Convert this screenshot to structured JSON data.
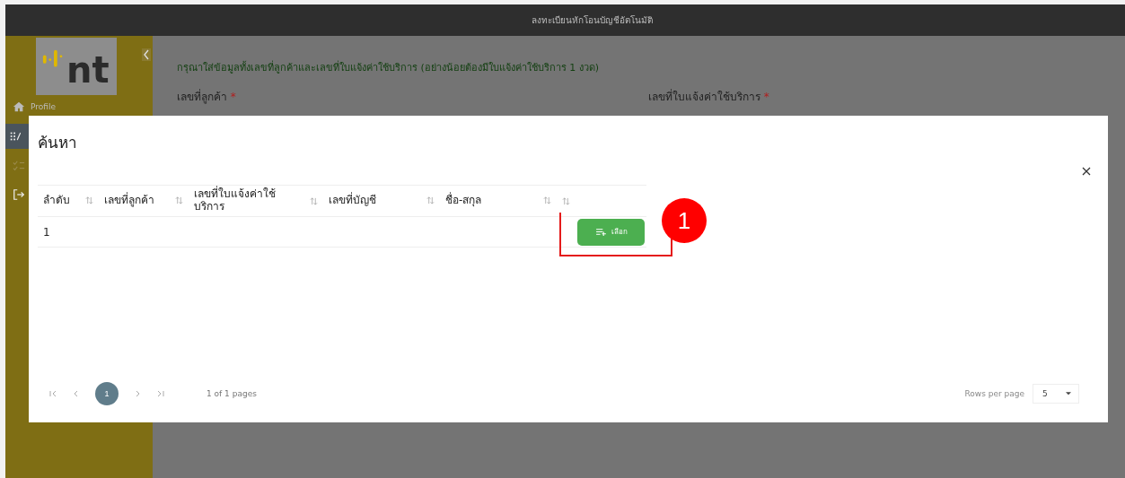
{
  "header": {
    "title": "ลงทะเบียนหักโอนบัญชีอัตโนมัติ"
  },
  "sidebar": {
    "logo": "nt",
    "items": [
      {
        "kind": "home",
        "label": "Profile",
        "selected": false
      },
      {
        "kind": "grid",
        "selected": true
      },
      {
        "kind": "checklist",
        "selected": false
      },
      {
        "kind": "logout",
        "selected": false
      }
    ]
  },
  "form": {
    "instruction": "กรุณาใส่ข้อมูลทั้งเลขที่ลูกค้าและเลขที่ใบแจ้งค่าใช้บริการ (อย่างน้อยต้องมีใบแจ้งค่าใช้บริการ 1 งวด)",
    "fields": [
      {
        "label": "เลขที่ลูกค้า",
        "mark": "*"
      },
      {
        "label": "เลขที่ใบแจ้งค่าใช้บริการ",
        "mark": "*"
      }
    ]
  },
  "dialog": {
    "title": "ค้นหา",
    "columns": [
      {
        "label": "ลำดับ",
        "sortable": true
      },
      {
        "label": "เลขที่ลูกค้า",
        "sortable": true
      },
      {
        "label": "เลขที่ใบแจ้งค่าใช้บริการ",
        "sortable": true
      },
      {
        "label": "เลขที่บัญชี",
        "sortable": true
      },
      {
        "label": "ชื่อ-สกุล",
        "sortable": true
      },
      {
        "sortable": true
      }
    ],
    "rows": [
      {
        "number": "1",
        "button": "เลือก"
      }
    ],
    "pagination": {
      "pages": [
        {
          "label": "1",
          "selected": true
        }
      ],
      "summary": "1 of 1 pages",
      "rows_label": "Rows per page",
      "rows_value": "5"
    }
  },
  "annotation": {
    "label": "1"
  }
}
